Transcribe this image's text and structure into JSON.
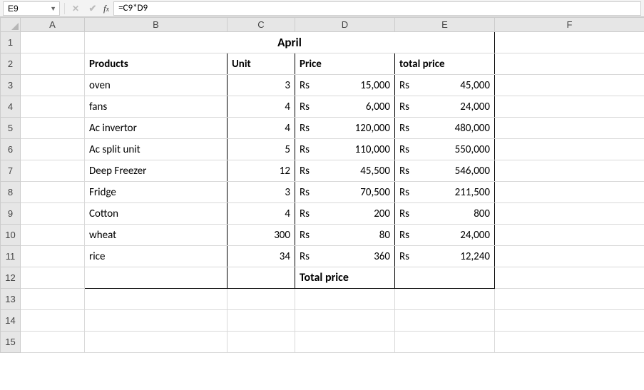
{
  "formula_bar": {
    "cell_ref": "E9",
    "formula": "=C9*D9"
  },
  "columns": [
    "A",
    "B",
    "C",
    "D",
    "E",
    "F"
  ],
  "rows": [
    "1",
    "2",
    "3",
    "4",
    "5",
    "6",
    "7",
    "8",
    "9",
    "10",
    "11",
    "12",
    "13",
    "14",
    "15"
  ],
  "header": {
    "title": "April",
    "products_label": "Products",
    "unit_label": "Unit",
    "price_label": "Price",
    "total_label": "total price"
  },
  "currency": "Rs",
  "items": [
    {
      "product": "oven",
      "unit": "3",
      "price": "15,000",
      "total": "45,000"
    },
    {
      "product": "fans",
      "unit": "4",
      "price": "6,000",
      "total": "24,000"
    },
    {
      "product": "Ac invertor",
      "unit": "4",
      "price": "120,000",
      "total": "480,000"
    },
    {
      "product": "Ac split unit",
      "unit": "5",
      "price": "110,000",
      "total": "550,000"
    },
    {
      "product": "Deep Freezer",
      "unit": "12",
      "price": "45,500",
      "total": "546,000"
    },
    {
      "product": "Fridge",
      "unit": "3",
      "price": "70,500",
      "total": "211,500"
    },
    {
      "product": "Cotton",
      "unit": "4",
      "price": "200",
      "total": "800"
    },
    {
      "product": "wheat",
      "unit": "300",
      "price": "80",
      "total": "24,000"
    },
    {
      "product": "rice",
      "unit": "34",
      "price": "360",
      "total": "12,240"
    }
  ],
  "footer": {
    "total_label": "Total price"
  },
  "chart_data": {
    "type": "table",
    "title": "April",
    "columns": [
      "Products",
      "Unit",
      "Price",
      "total price"
    ],
    "currency": "Rs",
    "rows": [
      [
        "oven",
        3,
        15000,
        45000
      ],
      [
        "fans",
        4,
        6000,
        24000
      ],
      [
        "Ac invertor",
        4,
        120000,
        480000
      ],
      [
        "Ac split unit",
        5,
        110000,
        550000
      ],
      [
        "Deep Freezer",
        12,
        45500,
        546000
      ],
      [
        "Fridge",
        3,
        70500,
        211500
      ],
      [
        "Cotton",
        4,
        200,
        800
      ],
      [
        "wheat",
        300,
        80,
        24000
      ],
      [
        "rice",
        34,
        360,
        12240
      ]
    ],
    "footer_label": "Total price"
  }
}
